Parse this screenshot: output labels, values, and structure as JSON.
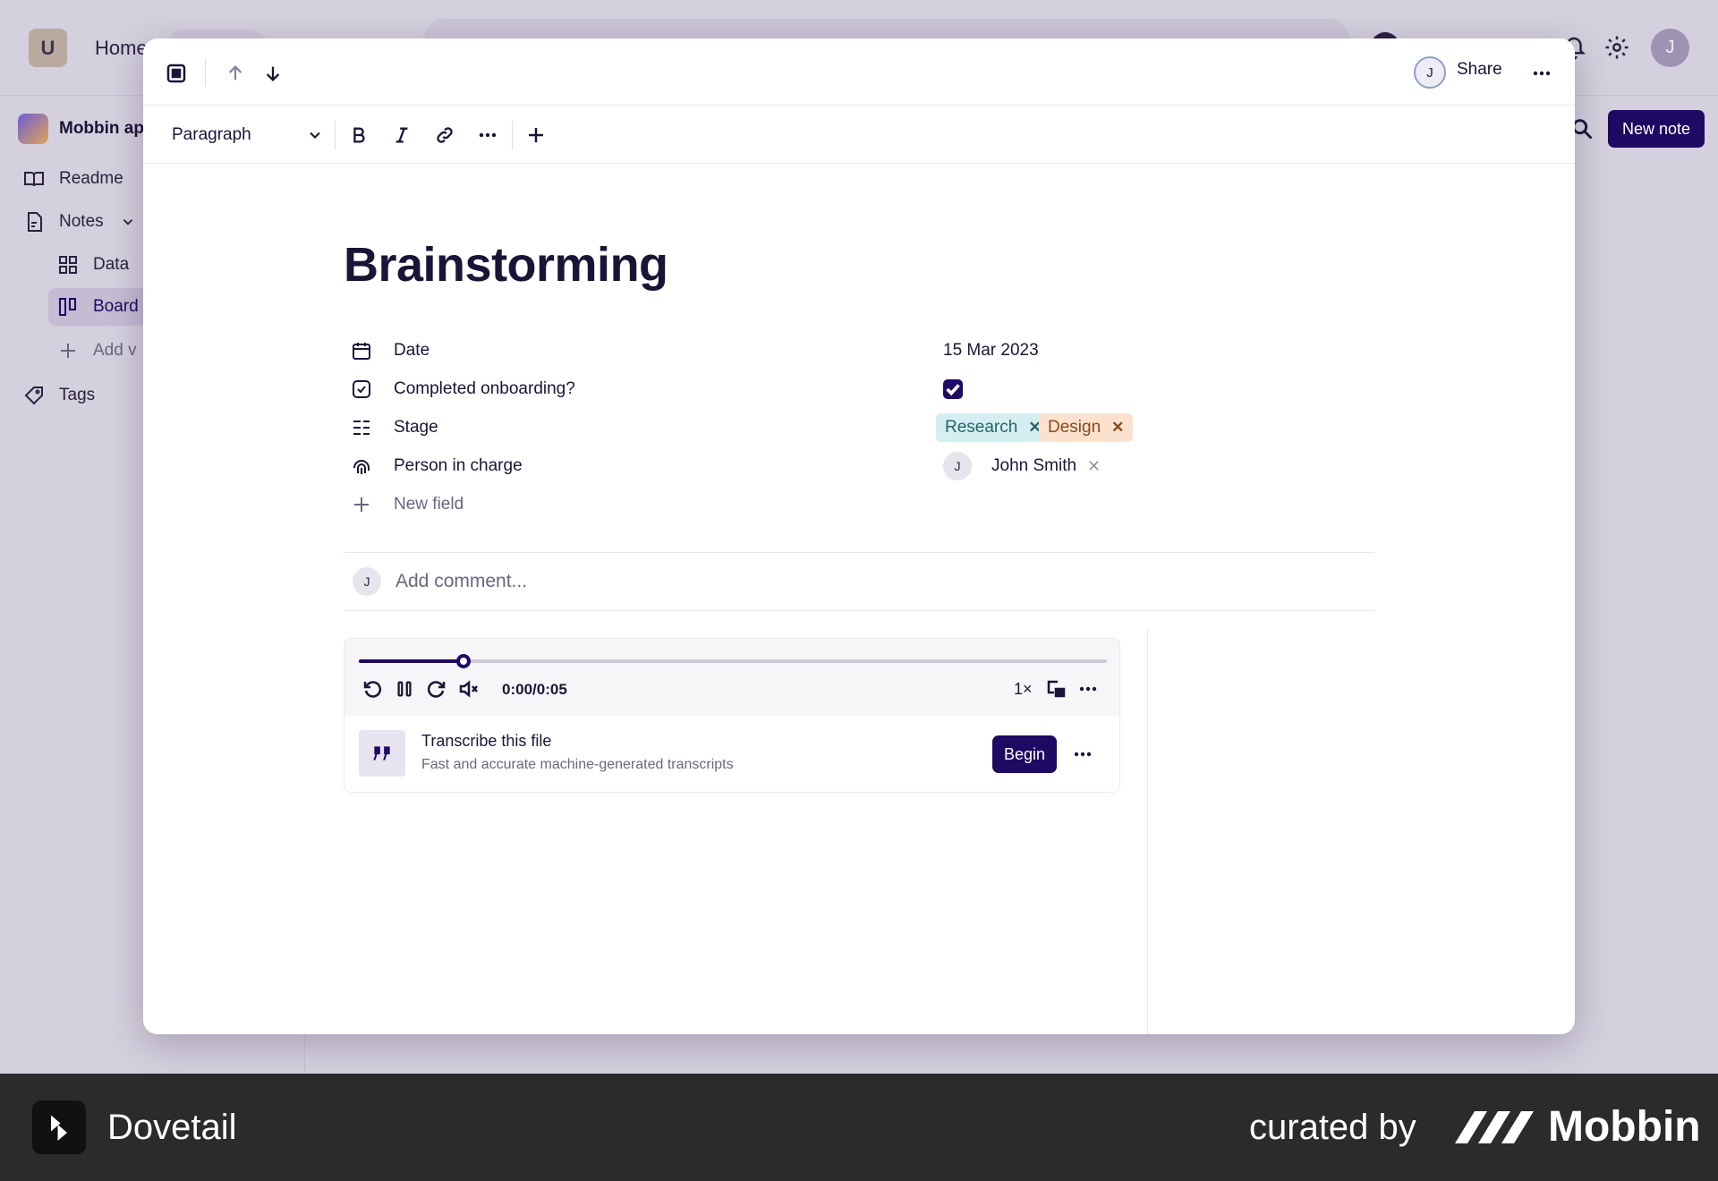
{
  "background_app": {
    "workspace_initial": "U",
    "home_label": "Home",
    "user_initial": "J",
    "project_name": "Mobbin ap",
    "sidebar": {
      "readme": "Readme",
      "notes": "Notes",
      "data": "Data",
      "board": "Board",
      "add_view": "Add v",
      "tags": "Tags"
    },
    "new_note_label": "New note"
  },
  "modal": {
    "header": {
      "avatar_initial": "J",
      "share_label": "Share"
    },
    "toolbar": {
      "paragraph_label": "Paragraph"
    },
    "title": "Brainstorming",
    "properties": {
      "date": {
        "label": "Date",
        "value": "15 Mar 2023"
      },
      "onboarding": {
        "label": "Completed onboarding?",
        "checked": true
      },
      "stage": {
        "label": "Stage",
        "tags": [
          "Research",
          "Design"
        ]
      },
      "person": {
        "label": "Person in charge",
        "initial": "J",
        "name": "John Smith"
      },
      "new_field": "New field"
    },
    "comment": {
      "avatar_initial": "J",
      "placeholder": "Add comment..."
    },
    "audio": {
      "time": "0:00/0:05",
      "speed": "1×",
      "progress": 0.14,
      "transcribe_title": "Transcribe this file",
      "transcribe_subtitle": "Fast and accurate machine-generated transcripts",
      "begin_label": "Begin"
    }
  },
  "footer": {
    "brand": "Dovetail",
    "curated_by": "curated by",
    "mobbin": "Mobbin"
  },
  "colors": {
    "accent": "#1e0a63",
    "research_tag_bg": "#d5eef1",
    "design_tag_bg": "#fbe2cf"
  }
}
